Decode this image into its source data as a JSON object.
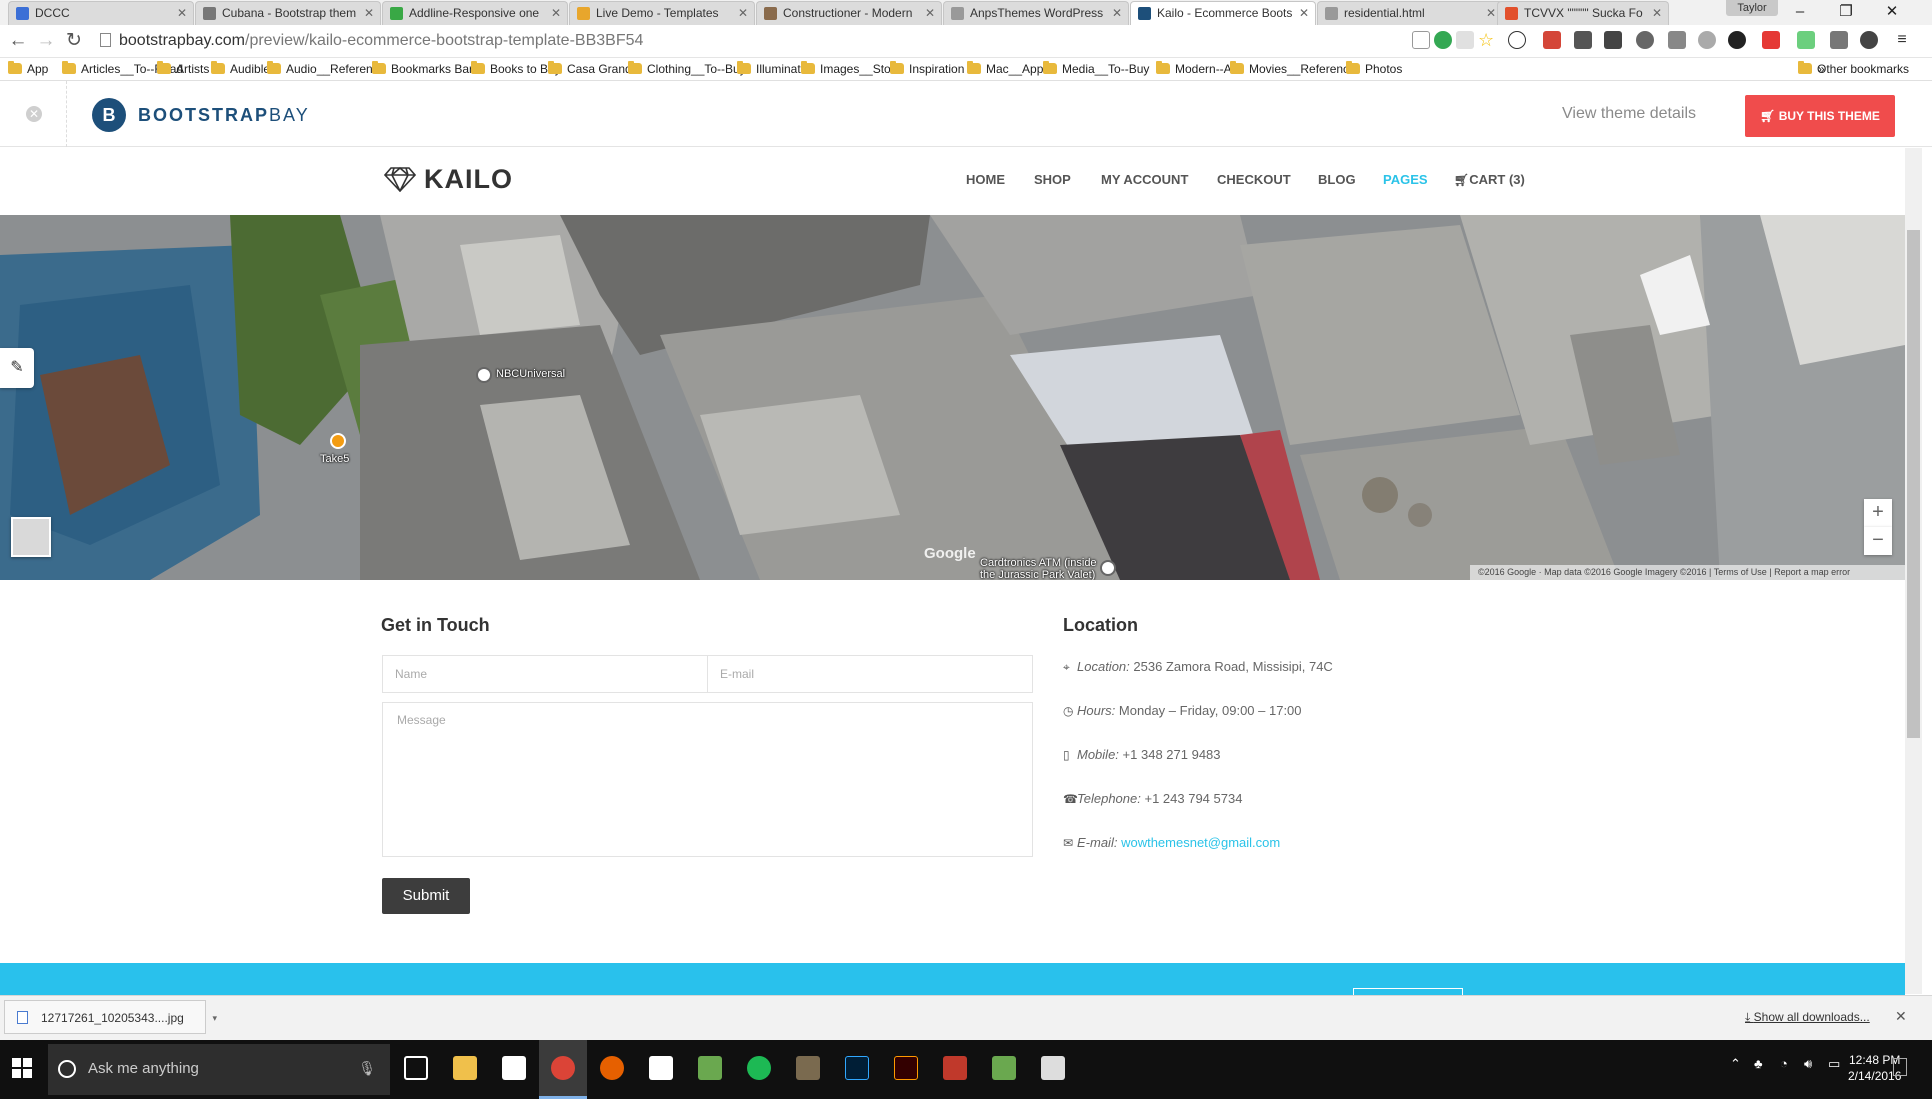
{
  "browser": {
    "tabs": [
      {
        "title": "DCCC",
        "color": "#3b6fd6"
      },
      {
        "title": "Cubana - Bootstrap them",
        "color": "#777777"
      },
      {
        "title": "Addline-Responsive one",
        "color": "#39a845"
      },
      {
        "title": "Live Demo - Templates",
        "color": "#e8a62c"
      },
      {
        "title": "Constructioner - Modern",
        "color": "#8a6b4c"
      },
      {
        "title": "AnpsThemes WordPress",
        "color": "#999999"
      },
      {
        "title": "Kailo - Ecommerce Boots",
        "color": "#1d4f7a",
        "active": true
      },
      {
        "title": "residential.html",
        "color": "#999999"
      },
      {
        "title": "TCVVX \"\"\"\"\" Sucka Fo",
        "color": "#e2502c"
      }
    ],
    "profile": "Taylor",
    "url": {
      "host": "bootstrapbay.com",
      "path": "/preview/kailo-ecommerce-bootstrap-template-BB3BF54"
    },
    "bookmarks": [
      "App",
      "Articles__To--Read",
      "Artists",
      "Audible",
      "Audio__Reference",
      "Bookmarks Bar",
      "Books to Buy",
      "Casa Grande",
      "Clothing__To--Buy",
      "Illuminati",
      "Images__Stock",
      "Inspiration",
      "Mac__Apps",
      "Media__To--Buy",
      "Modern--Art",
      "Movies__Reference",
      "Photos"
    ],
    "overflow": "»",
    "other_bookmarks": "Other bookmarks"
  },
  "bootstrapbay": {
    "brand_bold": "BOOTSTRAP",
    "brand_light": "BAY",
    "logo_letter": "B",
    "view_details": "View theme details",
    "buy_button": "BUY THIS THEME",
    "accent": "#f04c4c"
  },
  "kailo": {
    "logo": "KAILO",
    "menu": [
      {
        "label": "HOME"
      },
      {
        "label": "SHOP"
      },
      {
        "label": "MY ACCOUNT"
      },
      {
        "label": "CHECKOUT"
      },
      {
        "label": "BLOG"
      },
      {
        "label": "PAGES",
        "active": true
      },
      {
        "label": "CART (3)",
        "icon": "cart-icon"
      }
    ],
    "accent": "#2bc3e8"
  },
  "map": {
    "labels": {
      "nbc": "NBCUniversal",
      "take5": "Take5",
      "atm_line1": "Cardtronics ATM (inside",
      "atm_line2": "the Jurassic Park Valet)",
      "google": "Google"
    },
    "footer": "©2016 Google · Map data ©2016 Google Imagery ©2016   |   Terms of Use   |   Report a map error",
    "zoom_in": "+",
    "zoom_out": "−"
  },
  "contact": {
    "title": "Get in Touch",
    "name_placeholder": "Name",
    "email_placeholder": "E-mail",
    "message_placeholder": "Message",
    "submit": "Submit"
  },
  "location": {
    "title": "Location",
    "rows": [
      {
        "icon": "map-marker-icon",
        "label": "Location:",
        "value": "2536 Zamora Road, Missisipi, 74C"
      },
      {
        "icon": "clock-icon",
        "label": "Hours:",
        "value": "Monday – Friday, 09:00 – 17:00"
      },
      {
        "icon": "mobile-icon",
        "label": "Mobile:",
        "value": "+1 348 271 9483"
      },
      {
        "icon": "phone-icon",
        "label": "Telephone:",
        "value": "+1 243 794 5734"
      },
      {
        "icon": "envelope-icon",
        "label": "E-mail:",
        "value": "wowthemesnet@gmail.com",
        "link": true
      }
    ]
  },
  "downloads": {
    "file": "12717261_10205343....jpg",
    "show_all": "Show all downloads..."
  },
  "taskbar": {
    "search_placeholder": "Ask me anything",
    "time": "12:48 PM",
    "date": "2/14/2016"
  }
}
